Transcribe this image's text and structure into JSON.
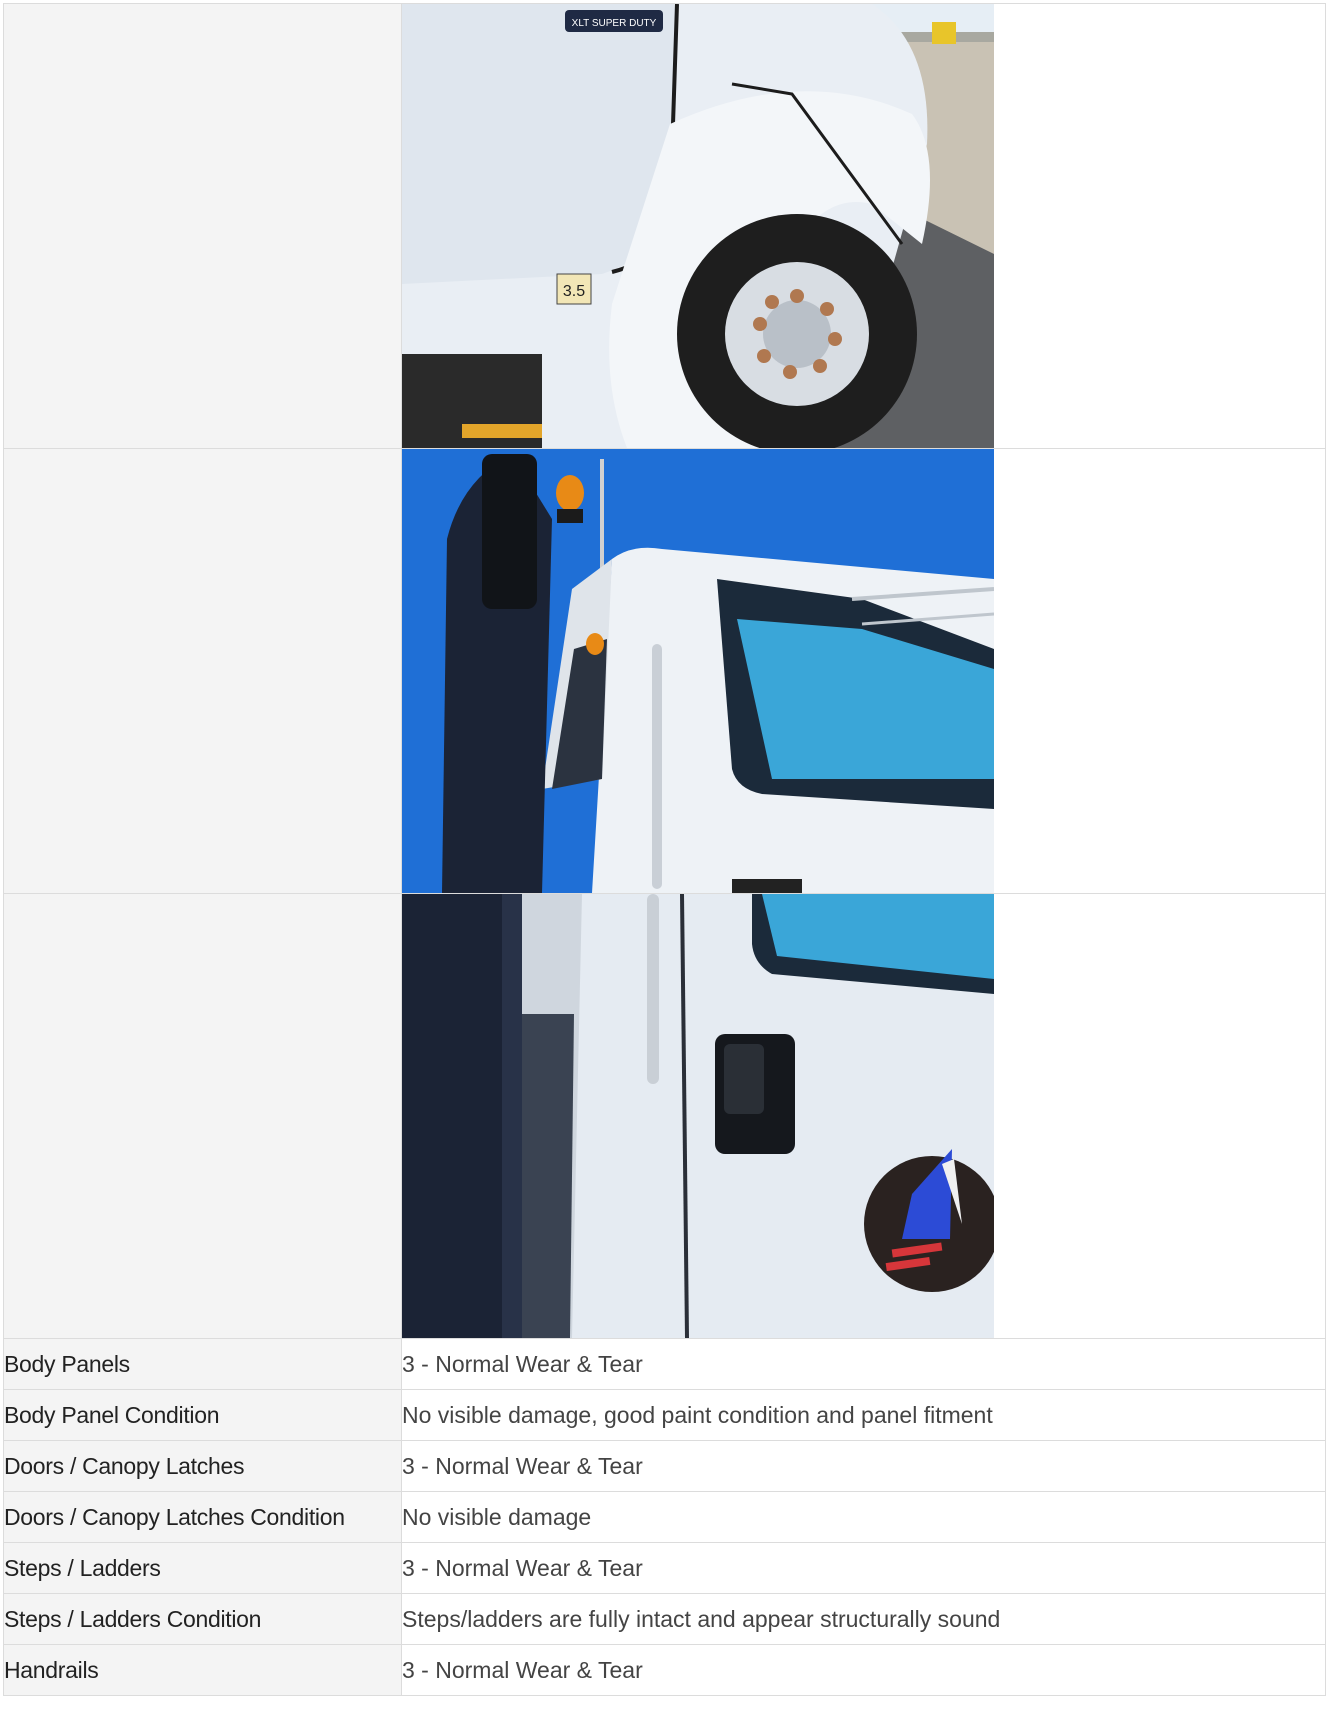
{
  "photos": [
    {
      "alt": "Front fender and wheel of white truck",
      "badge": "XLT SUPER DUTY",
      "emblem": "3.5"
    },
    {
      "alt": "Cab door and window with blue sky"
    },
    {
      "alt": "Cab door handle and logo decal"
    }
  ],
  "rows": [
    {
      "label": "Body Panels",
      "value": "3 - Normal Wear & Tear"
    },
    {
      "label": "Body Panel Condition",
      "value": "No visible damage, good paint condition and panel fitment"
    },
    {
      "label": "Doors / Canopy Latches",
      "value": "3 - Normal Wear & Tear"
    },
    {
      "label": "Doors / Canopy Latches Condition",
      "value": "No visible damage"
    },
    {
      "label": "Steps / Ladders",
      "value": "3 - Normal Wear & Tear"
    },
    {
      "label": "Steps / Ladders Condition",
      "value": "Steps/ladders are fully intact and appear structurally sound"
    },
    {
      "label": "Handrails",
      "value": "3 - Normal Wear & Tear"
    }
  ],
  "colors": {
    "label_bg": "#f4f4f4",
    "border": "#dcdcdc",
    "sky": "#1f6fd6",
    "truck_white": "#e8edf3"
  }
}
